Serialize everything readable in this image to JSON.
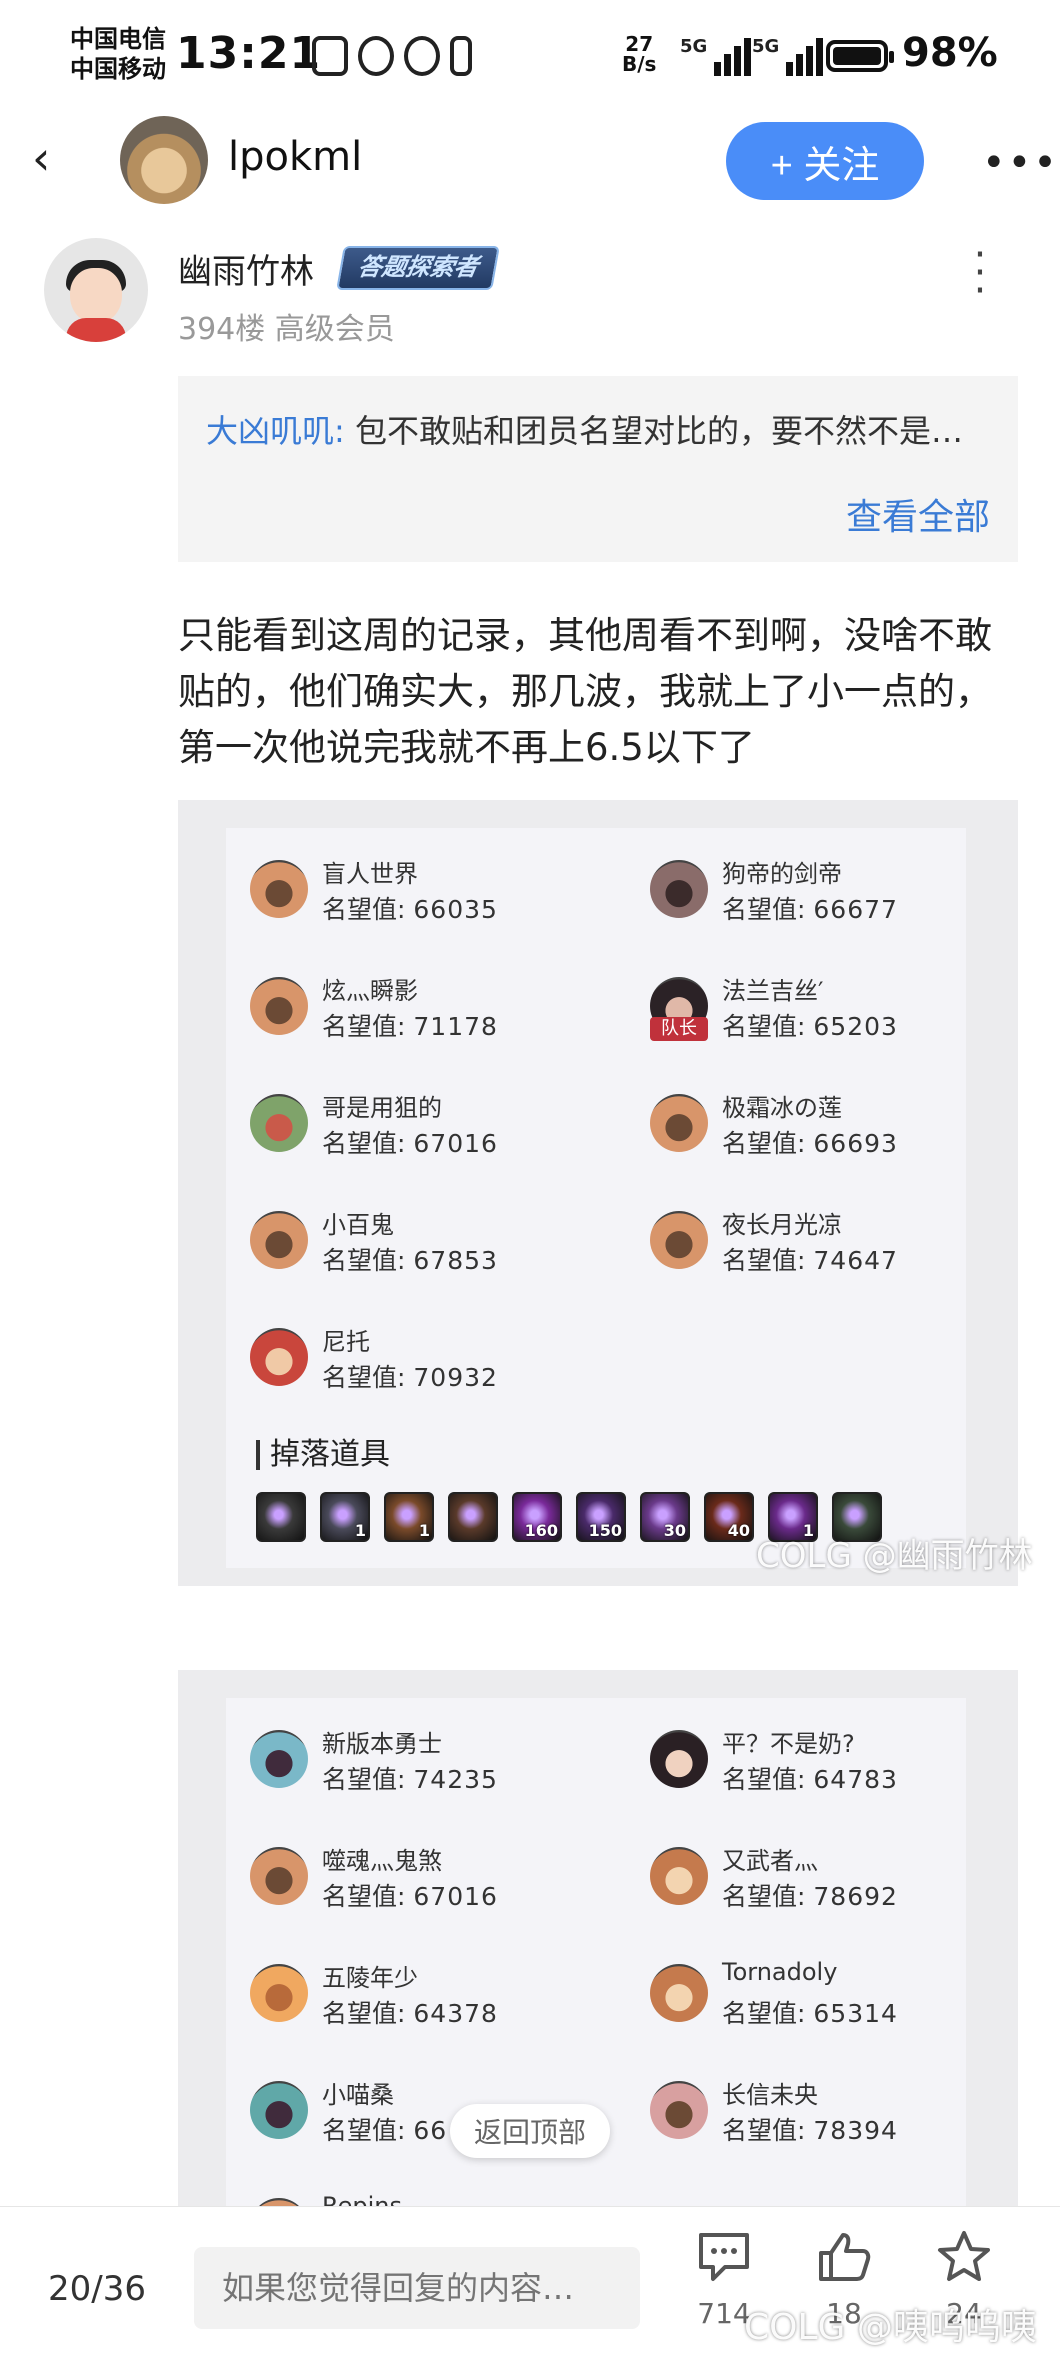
{
  "status": {
    "carrier1": "中国电信",
    "carrier2": "中国移动",
    "time": "13:21",
    "net_speed_top": "27",
    "net_speed_unit": "B/s",
    "sim1": "5G",
    "sim2": "5G",
    "battery": "98%"
  },
  "header": {
    "username": "lpokml",
    "follow_label": "+ 关注",
    "more_label": "•••"
  },
  "post": {
    "author": "幽雨竹林",
    "badge": "答题探索者",
    "meta": "394楼 高级会员",
    "quote": {
      "author": "大凶叽叽:",
      "text": " 包不敢贴和团员名望对比的，要不然不是…",
      "view_all": "查看全部"
    },
    "body": "只能看到这周的记录，其他周看不到啊，没啥不敢贴的，他们确实大，那几波，我就上了小一点的，第一次他说完我就不再上6.5以下了"
  },
  "screenshot1": {
    "value_label": "名望值:",
    "members": [
      {
        "name": "盲人世界",
        "value": "66035"
      },
      {
        "name": "狗帝的剑帝",
        "value": "66677"
      },
      {
        "name": "炫灬瞬影",
        "value": "71178"
      },
      {
        "name": "法兰吉丝′",
        "value": "65203",
        "captain": "队长"
      },
      {
        "name": "哥是用狙的",
        "value": "67016"
      },
      {
        "name": "极霜冰の莲",
        "value": "66693"
      },
      {
        "name": "小百鬼",
        "value": "67853"
      },
      {
        "name": "夜长月光凉",
        "value": "74647"
      },
      {
        "name": "尼托",
        "value": "70932"
      }
    ],
    "drops_title": "掉落道具",
    "drops": [
      "",
      "1",
      "1",
      "",
      "160",
      "150",
      "30",
      "40",
      "1",
      ""
    ],
    "watermark": "COLG @幽雨竹林"
  },
  "screenshot2": {
    "value_label": "名望值:",
    "members": [
      {
        "name": "新版本勇士",
        "value": "74235"
      },
      {
        "name": "平？不是奶?",
        "value": "64783"
      },
      {
        "name": "噬魂灬鬼煞",
        "value": "67016"
      },
      {
        "name": "又武者灬",
        "value": "78692"
      },
      {
        "name": "五陵年少",
        "value": "64378"
      },
      {
        "name": "Tornadoly",
        "value": "65314"
      },
      {
        "name": "小喵桑",
        "value": "66"
      },
      {
        "name": "长信未央",
        "value": "78394"
      },
      {
        "name": "Repins",
        "value": ""
      }
    ]
  },
  "back_to_top": "返回顶部",
  "bottom": {
    "page_indicator": "20/36",
    "reply_placeholder": "如果您觉得回复的内容…",
    "comments": "714",
    "likes": "18",
    "stars": "24",
    "watermark": "COLG @咦呜呜咦"
  },
  "colors": {
    "accent": "#4a8df8",
    "link": "#3a7bd5",
    "captain": "#c0313b"
  }
}
